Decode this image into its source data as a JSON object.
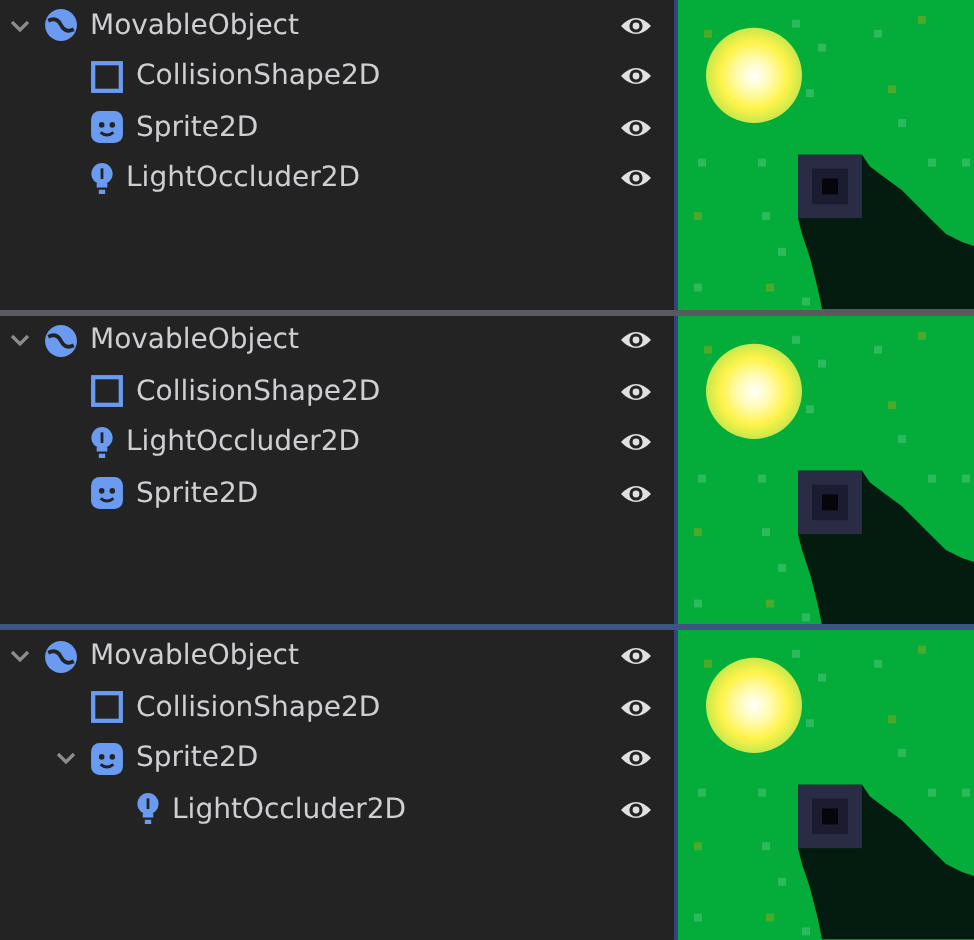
{
  "panels": [
    {
      "focused": false,
      "tree": [
        {
          "name": "MovableObject",
          "kind": "body",
          "visible": true,
          "expanded": true,
          "children": [
            {
              "name": "CollisionShape2D",
              "kind": "shape",
              "visible": true
            },
            {
              "name": "Sprite2D",
              "kind": "sprite",
              "visible": true
            },
            {
              "name": "LightOccluder2D",
              "kind": "occluder",
              "visible": true
            }
          ]
        }
      ]
    },
    {
      "focused": false,
      "tree": [
        {
          "name": "MovableObject",
          "kind": "body",
          "visible": true,
          "expanded": true,
          "children": [
            {
              "name": "CollisionShape2D",
              "kind": "shape",
              "visible": true
            },
            {
              "name": "LightOccluder2D",
              "kind": "occluder",
              "visible": true
            },
            {
              "name": "Sprite2D",
              "kind": "sprite",
              "visible": true
            }
          ]
        }
      ]
    },
    {
      "focused": true,
      "tree": [
        {
          "name": "MovableObject",
          "kind": "body",
          "visible": true,
          "expanded": true,
          "children": [
            {
              "name": "CollisionShape2D",
              "kind": "shape",
              "visible": true
            },
            {
              "name": "Sprite2D",
              "kind": "sprite",
              "visible": true,
              "expanded": true,
              "children": [
                {
                  "name": "LightOccluder2D",
                  "kind": "occluder",
                  "visible": true
                }
              ]
            }
          ]
        }
      ]
    }
  ]
}
